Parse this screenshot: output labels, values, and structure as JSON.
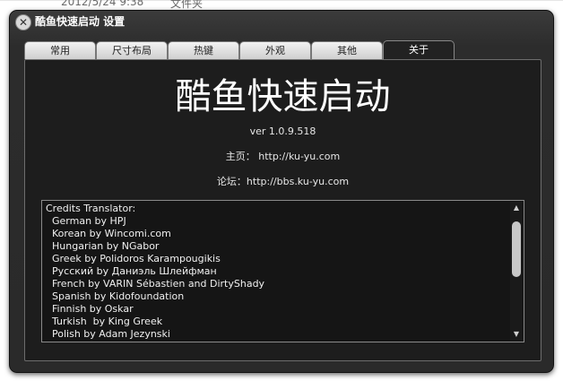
{
  "background": {
    "date_text": "2012/5/24 9:38",
    "type_text": "文件夹"
  },
  "window": {
    "title": "酷鱼快速启动 设置",
    "close_glyph": "✕"
  },
  "tabs": [
    {
      "label": "常用",
      "active": false
    },
    {
      "label": "尺寸布局",
      "active": false
    },
    {
      "label": "热键",
      "active": false
    },
    {
      "label": "外观",
      "active": false
    },
    {
      "label": "其他",
      "active": false
    },
    {
      "label": "关于",
      "active": true
    }
  ],
  "about": {
    "app_name": "酷鱼快速启动",
    "version": "ver 1.0.9.518",
    "homepage": "主页： http://ku-yu.com",
    "forum": "论坛：http://bbs.ku-yu.com"
  },
  "credits": {
    "header": "Credits Translator:",
    "items": [
      "German by HPJ",
      "Korean by Wincomi.com",
      "Hungarian by NGabor",
      "Greek by Polidoros Karampougikis",
      "Русский by Даниэль Шлейфман",
      "French by VARIN Sébastien and DirtyShady",
      "Spanish by Kidofoundation",
      "Finnish by Oskar",
      "Turkish  by King Greek",
      "Polish by Adam Jezynski"
    ]
  },
  "scrollbar": {
    "up_icon": "▲",
    "down_icon": "▼"
  }
}
